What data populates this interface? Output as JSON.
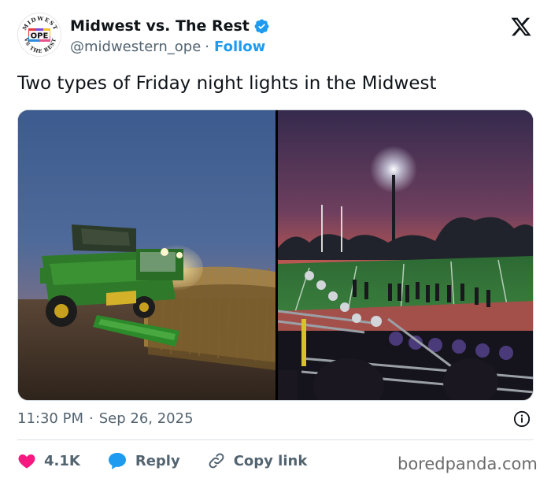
{
  "account": {
    "display_name": "Midwest vs. The Rest",
    "handle": "@midwestern_ope",
    "separator": "·",
    "follow_label": "Follow",
    "avatar_text_top": "MIDWEST",
    "avatar_text_center": "OPE",
    "avatar_text_bottom": "VS THE REST",
    "verified_color": "#1d9bf0"
  },
  "tweet": {
    "text": "Two types of Friday night lights in the Midwest",
    "time": "11:30 PM",
    "separator": "·",
    "date": "Sep 26, 2025"
  },
  "media": {
    "left_image": "combine harvester in cornfield at dusk",
    "right_image": "football field under stadium light at sunset"
  },
  "actions": {
    "like_count": "4.1K",
    "reply_label": "Reply",
    "copy_link_label": "Copy link"
  },
  "watermark": "boredpanda.com",
  "icons": {
    "brand": "x-logo-icon",
    "verified": "verified-badge-icon",
    "info": "info-icon",
    "like": "heart-icon",
    "reply": "speech-bubble-icon",
    "copy": "link-icon"
  },
  "colors": {
    "like": "#f91880",
    "reply": "#1d9bf0",
    "follow": "#1d9bf0",
    "muted": "#536471"
  }
}
